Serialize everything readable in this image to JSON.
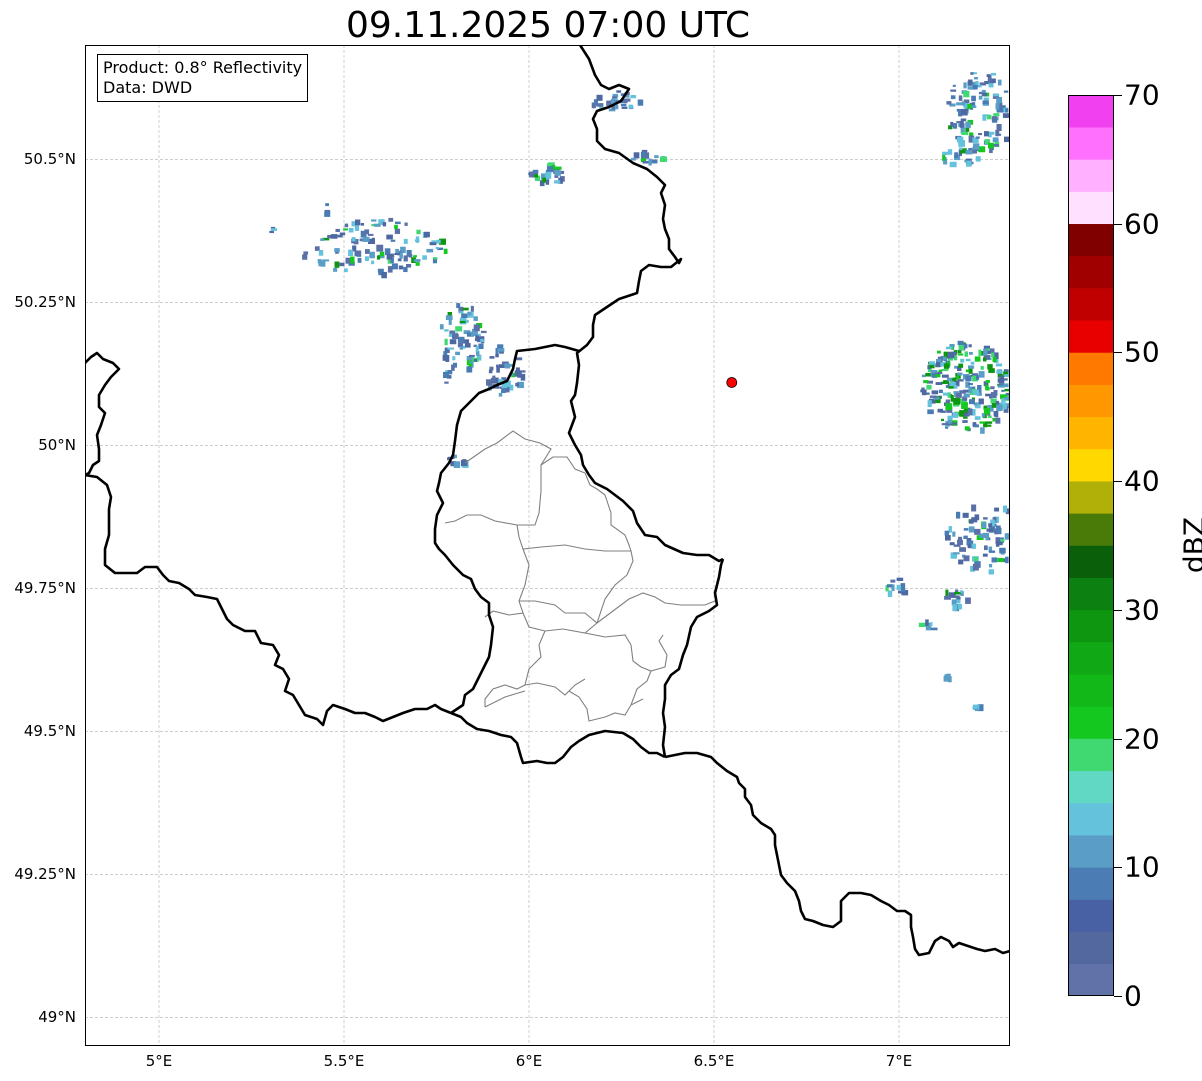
{
  "title": "09.11.2025 07:00 UTC",
  "info": {
    "product": "Product: 0.8° Reflectivity",
    "data": "Data: DWD"
  },
  "map": {
    "extent": {
      "lon": [
        4.8,
        7.3
      ],
      "lat": [
        48.95,
        50.7
      ]
    },
    "gridlines": true,
    "lat_ticks": [
      {
        "value": 50.5,
        "label": "50.5°N"
      },
      {
        "value": 50.25,
        "label": "50.25°N"
      },
      {
        "value": 50.0,
        "label": "50°N"
      },
      {
        "value": 49.75,
        "label": "49.75°N"
      },
      {
        "value": 49.5,
        "label": "49.5°N"
      },
      {
        "value": 49.25,
        "label": "49.25°N"
      },
      {
        "value": 49.0,
        "label": "49°N"
      }
    ],
    "lon_ticks": [
      {
        "value": 5.0,
        "label": "5°E"
      },
      {
        "value": 5.5,
        "label": "5.5°E"
      },
      {
        "value": 6.0,
        "label": "6°E"
      },
      {
        "value": 6.5,
        "label": "6.5°E"
      },
      {
        "value": 7.0,
        "label": "7°E"
      }
    ],
    "radar_site": {
      "lon": 6.548,
      "lat": 50.11,
      "color": "#ff0000"
    },
    "borders_color": "#000000",
    "admin_color": "#808080"
  },
  "colorbar": {
    "label": "dBZ",
    "min": 0,
    "max": 70,
    "ticks": [
      {
        "value": 0,
        "label": "0"
      },
      {
        "value": 10,
        "label": "10"
      },
      {
        "value": 20,
        "label": "20"
      },
      {
        "value": 30,
        "label": "30"
      },
      {
        "value": 40,
        "label": "40"
      },
      {
        "value": 50,
        "label": "50"
      },
      {
        "value": 60,
        "label": "60"
      },
      {
        "value": 70,
        "label": "70"
      }
    ],
    "colors": [
      "#6072a8",
      "#5468a0",
      "#4860a4",
      "#4c7cb4",
      "#5a9ec8",
      "#64c2dc",
      "#60d8c4",
      "#40d870",
      "#14c820",
      "#12b818",
      "#10a814",
      "#0e9610",
      "#0c8010",
      "#0a600a",
      "#4a7a08",
      "#b0b008",
      "#ffd800",
      "#ffb400",
      "#ff9800",
      "#ff7800",
      "#e80000",
      "#c00000",
      "#a00000",
      "#800000",
      "#ffe0ff",
      "#ffb0ff",
      "#ff70ff",
      "#f040f0"
    ]
  }
}
